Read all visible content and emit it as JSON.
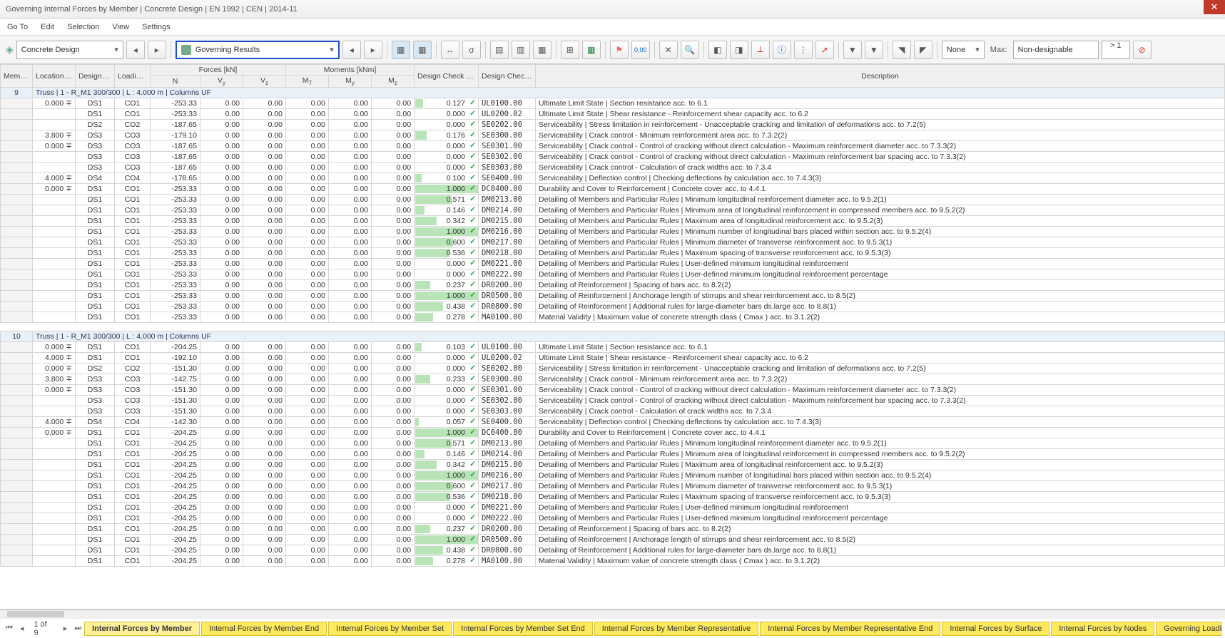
{
  "title": "Governing Internal Forces by Member | Concrete Design | EN 1992 | CEN | 2014-11",
  "menus": [
    "Go To",
    "Edit",
    "Selection",
    "View",
    "Settings"
  ],
  "toolbar": {
    "category_select": "Concrete Design",
    "result_select": "Governing Results",
    "filter1_label": "None",
    "filter2_label": "Max:",
    "filter2_value": "Non-designable",
    "gt_label": "> 1"
  },
  "headers": {
    "member": "Member No.",
    "location": "Location x [m]",
    "ds": "Design Situation",
    "lo": "Loading No.",
    "forces_group": "Forces [kN]",
    "moments_group": "Moments [kNm]",
    "ratio": "Design Check Ratio η [-]",
    "type": "Design Check Type",
    "desc": "Description",
    "N": "N",
    "Vy": "Vy",
    "Vz": "Vz",
    "Mt": "MT",
    "My": "My",
    "Mz": "Mz"
  },
  "groups": [
    {
      "member": "9",
      "title": "Truss | 1 - R_M1 300/300 | L : 4.000 m | Columns UF",
      "rows": [
        {
          "loc": "0.000",
          "ds": "DS1",
          "lo": "CO1",
          "n": "-253.33",
          "vy": "0.00",
          "vz": "0.00",
          "mt": "0.00",
          "my": "0.00",
          "mz": "0.00",
          "ratio": "0.127",
          "type": "UL0100.00",
          "desc": "Ultimate Limit State | Section resistance acc. to 6.1"
        },
        {
          "loc": "",
          "ds": "DS1",
          "lo": "CO1",
          "n": "-253.33",
          "vy": "0.00",
          "vz": "0.00",
          "mt": "0.00",
          "my": "0.00",
          "mz": "0.00",
          "ratio": "0.000",
          "type": "UL0200.02",
          "desc": "Ultimate Limit State | Shear resistance - Reinforcement shear capacity acc. to 6.2"
        },
        {
          "loc": "",
          "ds": "DS2",
          "lo": "CO2",
          "n": "-187.65",
          "vy": "0.00",
          "vz": "0.00",
          "mt": "0.00",
          "my": "0.00",
          "mz": "0.00",
          "ratio": "0.000",
          "type": "SE0202.00",
          "desc": "Serviceability | Stress limitation in reinforcement - Unacceptable cracking and limitation of deformations acc. to 7.2(5)"
        },
        {
          "loc": "3.800",
          "ds": "DS3",
          "lo": "CO3",
          "n": "-179.10",
          "vy": "0.00",
          "vz": "0.00",
          "mt": "0.00",
          "my": "0.00",
          "mz": "0.00",
          "ratio": "0.176",
          "type": "SE0300.00",
          "desc": "Serviceability | Crack control - Minimum reinforcement area acc. to 7.3.2(2)"
        },
        {
          "loc": "0.000",
          "ds": "DS3",
          "lo": "CO3",
          "n": "-187.65",
          "vy": "0.00",
          "vz": "0.00",
          "mt": "0.00",
          "my": "0.00",
          "mz": "0.00",
          "ratio": "0.000",
          "type": "SE0301.00",
          "desc": "Serviceability | Crack control - Control of cracking without direct calculation - Maximum reinforcement diameter acc. to 7.3.3(2)"
        },
        {
          "loc": "",
          "ds": "DS3",
          "lo": "CO3",
          "n": "-187.65",
          "vy": "0.00",
          "vz": "0.00",
          "mt": "0.00",
          "my": "0.00",
          "mz": "0.00",
          "ratio": "0.000",
          "type": "SE0302.00",
          "desc": "Serviceability | Crack control - Control of cracking without direct calculation - Maximum reinforcement bar spacing acc. to 7.3.3(2)"
        },
        {
          "loc": "",
          "ds": "DS3",
          "lo": "CO3",
          "n": "-187.65",
          "vy": "0.00",
          "vz": "0.00",
          "mt": "0.00",
          "my": "0.00",
          "mz": "0.00",
          "ratio": "0.000",
          "type": "SE0303.00",
          "desc": "Serviceability | Crack control - Calculation of crack widths acc. to 7.3.4"
        },
        {
          "loc": "4.000",
          "ds": "DS4",
          "lo": "CO4",
          "n": "-178.65",
          "vy": "0.00",
          "vz": "0.00",
          "mt": "0.00",
          "my": "0.00",
          "mz": "0.00",
          "ratio": "0.100",
          "type": "SE0400.00",
          "desc": "Serviceability | Deflection control | Checking deflections by calculation acc. to 7.4.3(3)"
        },
        {
          "loc": "0.000",
          "ds": "DS1",
          "lo": "CO1",
          "n": "-253.33",
          "vy": "0.00",
          "vz": "0.00",
          "mt": "0.00",
          "my": "0.00",
          "mz": "0.00",
          "ratio": "1.000",
          "type": "DC0400.00",
          "desc": "Durability and Cover to Reinforcement | Concrete cover acc. to 4.4.1"
        },
        {
          "loc": "",
          "ds": "DS1",
          "lo": "CO1",
          "n": "-253.33",
          "vy": "0.00",
          "vz": "0.00",
          "mt": "0.00",
          "my": "0.00",
          "mz": "0.00",
          "ratio": "0.571",
          "type": "DM0213.00",
          "desc": "Detailing of Members and Particular Rules | Minimum longitudinal reinforcement diameter acc. to 9.5.2(1)"
        },
        {
          "loc": "",
          "ds": "DS1",
          "lo": "CO1",
          "n": "-253.33",
          "vy": "0.00",
          "vz": "0.00",
          "mt": "0.00",
          "my": "0.00",
          "mz": "0.00",
          "ratio": "0.146",
          "type": "DM0214.00",
          "desc": "Detailing of Members and Particular Rules | Minimum area of longitudinal reinforcement in compressed members acc. to 9.5.2(2)"
        },
        {
          "loc": "",
          "ds": "DS1",
          "lo": "CO1",
          "n": "-253.33",
          "vy": "0.00",
          "vz": "0.00",
          "mt": "0.00",
          "my": "0.00",
          "mz": "0.00",
          "ratio": "0.342",
          "type": "DM0215.00",
          "desc": "Detailing of Members and Particular Rules | Maximum area of longitudinal reinforcement acc. to 9.5.2(3)"
        },
        {
          "loc": "",
          "ds": "DS1",
          "lo": "CO1",
          "n": "-253.33",
          "vy": "0.00",
          "vz": "0.00",
          "mt": "0.00",
          "my": "0.00",
          "mz": "0.00",
          "ratio": "1.000",
          "type": "DM0216.00",
          "desc": "Detailing of Members and Particular Rules | Minimum number of longitudinal bars placed within section acc. to 9.5.2(4)"
        },
        {
          "loc": "",
          "ds": "DS1",
          "lo": "CO1",
          "n": "-253.33",
          "vy": "0.00",
          "vz": "0.00",
          "mt": "0.00",
          "my": "0.00",
          "mz": "0.00",
          "ratio": "0.600",
          "type": "DM0217.00",
          "desc": "Detailing of Members and Particular Rules | Minimum diameter of transverse reinforcement acc. to 9.5.3(1)"
        },
        {
          "loc": "",
          "ds": "DS1",
          "lo": "CO1",
          "n": "-253.33",
          "vy": "0.00",
          "vz": "0.00",
          "mt": "0.00",
          "my": "0.00",
          "mz": "0.00",
          "ratio": "0.536",
          "type": "DM0218.00",
          "desc": "Detailing of Members and Particular Rules | Maximum spacing of transverse reinforcement acc. to 9.5.3(3)"
        },
        {
          "loc": "",
          "ds": "DS1",
          "lo": "CO1",
          "n": "-253.33",
          "vy": "0.00",
          "vz": "0.00",
          "mt": "0.00",
          "my": "0.00",
          "mz": "0.00",
          "ratio": "0.000",
          "type": "DM0221.00",
          "desc": "Detailing of Members and Particular Rules | User-defined minimum longitudinal reinforcement"
        },
        {
          "loc": "",
          "ds": "DS1",
          "lo": "CO1",
          "n": "-253.33",
          "vy": "0.00",
          "vz": "0.00",
          "mt": "0.00",
          "my": "0.00",
          "mz": "0.00",
          "ratio": "0.000",
          "type": "DM0222.00",
          "desc": "Detailing of Members and Particular Rules | User-defined minimum longitudinal reinforcement percentage"
        },
        {
          "loc": "",
          "ds": "DS1",
          "lo": "CO1",
          "n": "-253.33",
          "vy": "0.00",
          "vz": "0.00",
          "mt": "0.00",
          "my": "0.00",
          "mz": "0.00",
          "ratio": "0.237",
          "type": "DR0200.00",
          "desc": "Detailing of Reinforcement | Spacing of bars acc. to 8.2(2)"
        },
        {
          "loc": "",
          "ds": "DS1",
          "lo": "CO1",
          "n": "-253.33",
          "vy": "0.00",
          "vz": "0.00",
          "mt": "0.00",
          "my": "0.00",
          "mz": "0.00",
          "ratio": "1.000",
          "type": "DR0500.00",
          "desc": "Detailing of Reinforcement | Anchorage length of stirrups and shear reinforcement acc. to 8.5(2)"
        },
        {
          "loc": "",
          "ds": "DS1",
          "lo": "CO1",
          "n": "-253.33",
          "vy": "0.00",
          "vz": "0.00",
          "mt": "0.00",
          "my": "0.00",
          "mz": "0.00",
          "ratio": "0.438",
          "type": "DR0800.00",
          "desc": "Detailing of Reinforcement | Additional rules for large-diameter bars ds,large acc. to 8.8(1)"
        },
        {
          "loc": "",
          "ds": "DS1",
          "lo": "CO1",
          "n": "-253.33",
          "vy": "0.00",
          "vz": "0.00",
          "mt": "0.00",
          "my": "0.00",
          "mz": "0.00",
          "ratio": "0.278",
          "type": "MA0100.00",
          "desc": "Material Validity | Maximum value of concrete strength class ( Cmax ) acc. to 3.1.2(2)"
        }
      ]
    },
    {
      "member": "10",
      "title": "Truss | 1 - R_M1 300/300 | L : 4.000 m | Columns UF",
      "rows": [
        {
          "loc": "0.000",
          "ds": "DS1",
          "lo": "CO1",
          "n": "-204.25",
          "vy": "0.00",
          "vz": "0.00",
          "mt": "0.00",
          "my": "0.00",
          "mz": "0.00",
          "ratio": "0.103",
          "type": "UL0100.00",
          "desc": "Ultimate Limit State | Section resistance acc. to 6.1"
        },
        {
          "loc": "4.000",
          "ds": "DS1",
          "lo": "CO1",
          "n": "-192.10",
          "vy": "0.00",
          "vz": "0.00",
          "mt": "0.00",
          "my": "0.00",
          "mz": "0.00",
          "ratio": "0.000",
          "type": "UL0200.02",
          "desc": "Ultimate Limit State | Shear resistance - Reinforcement shear capacity acc. to 6.2"
        },
        {
          "loc": "0.000",
          "ds": "DS2",
          "lo": "CO2",
          "n": "-151.30",
          "vy": "0.00",
          "vz": "0.00",
          "mt": "0.00",
          "my": "0.00",
          "mz": "0.00",
          "ratio": "0.000",
          "type": "SE0202.00",
          "desc": "Serviceability | Stress limitation in reinforcement - Unacceptable cracking and limitation of deformations acc. to 7.2(5)"
        },
        {
          "loc": "3.800",
          "ds": "DS3",
          "lo": "CO3",
          "n": "-142.75",
          "vy": "0.00",
          "vz": "0.00",
          "mt": "0.00",
          "my": "0.00",
          "mz": "0.00",
          "ratio": "0.233",
          "type": "SE0300.00",
          "desc": "Serviceability | Crack control - Minimum reinforcement area acc. to 7.3.2(2)"
        },
        {
          "loc": "0.000",
          "ds": "DS3",
          "lo": "CO3",
          "n": "-151.30",
          "vy": "0.00",
          "vz": "0.00",
          "mt": "0.00",
          "my": "0.00",
          "mz": "0.00",
          "ratio": "0.000",
          "type": "SE0301.00",
          "desc": "Serviceability | Crack control - Control of cracking without direct calculation - Maximum reinforcement diameter acc. to 7.3.3(2)"
        },
        {
          "loc": "",
          "ds": "DS3",
          "lo": "CO3",
          "n": "-151.30",
          "vy": "0.00",
          "vz": "0.00",
          "mt": "0.00",
          "my": "0.00",
          "mz": "0.00",
          "ratio": "0.000",
          "type": "SE0302.00",
          "desc": "Serviceability | Crack control - Control of cracking without direct calculation - Maximum reinforcement bar spacing acc. to 7.3.3(2)"
        },
        {
          "loc": "",
          "ds": "DS3",
          "lo": "CO3",
          "n": "-151.30",
          "vy": "0.00",
          "vz": "0.00",
          "mt": "0.00",
          "my": "0.00",
          "mz": "0.00",
          "ratio": "0.000",
          "type": "SE0303.00",
          "desc": "Serviceability | Crack control - Calculation of crack widths acc. to 7.3.4"
        },
        {
          "loc": "4.000",
          "ds": "DS4",
          "lo": "CO4",
          "n": "-142.30",
          "vy": "0.00",
          "vz": "0.00",
          "mt": "0.00",
          "my": "0.00",
          "mz": "0.00",
          "ratio": "0.057",
          "type": "SE0400.00",
          "desc": "Serviceability | Deflection control | Checking deflections by calculation acc. to 7.4.3(3)"
        },
        {
          "loc": "0.000",
          "ds": "DS1",
          "lo": "CO1",
          "n": "-204.25",
          "vy": "0.00",
          "vz": "0.00",
          "mt": "0.00",
          "my": "0.00",
          "mz": "0.00",
          "ratio": "1.000",
          "type": "DC0400.00",
          "desc": "Durability and Cover to Reinforcement | Concrete cover acc. to 4.4.1"
        },
        {
          "loc": "",
          "ds": "DS1",
          "lo": "CO1",
          "n": "-204.25",
          "vy": "0.00",
          "vz": "0.00",
          "mt": "0.00",
          "my": "0.00",
          "mz": "0.00",
          "ratio": "0.571",
          "type": "DM0213.00",
          "desc": "Detailing of Members and Particular Rules | Minimum longitudinal reinforcement diameter acc. to 9.5.2(1)"
        },
        {
          "loc": "",
          "ds": "DS1",
          "lo": "CO1",
          "n": "-204.25",
          "vy": "0.00",
          "vz": "0.00",
          "mt": "0.00",
          "my": "0.00",
          "mz": "0.00",
          "ratio": "0.146",
          "type": "DM0214.00",
          "desc": "Detailing of Members and Particular Rules | Minimum area of longitudinal reinforcement in compressed members acc. to 9.5.2(2)"
        },
        {
          "loc": "",
          "ds": "DS1",
          "lo": "CO1",
          "n": "-204.25",
          "vy": "0.00",
          "vz": "0.00",
          "mt": "0.00",
          "my": "0.00",
          "mz": "0.00",
          "ratio": "0.342",
          "type": "DM0215.00",
          "desc": "Detailing of Members and Particular Rules | Maximum area of longitudinal reinforcement acc. to 9.5.2(3)"
        },
        {
          "loc": "",
          "ds": "DS1",
          "lo": "CO1",
          "n": "-204.25",
          "vy": "0.00",
          "vz": "0.00",
          "mt": "0.00",
          "my": "0.00",
          "mz": "0.00",
          "ratio": "1.000",
          "type": "DM0216.00",
          "desc": "Detailing of Members and Particular Rules | Minimum number of longitudinal bars placed within section acc. to 9.5.2(4)"
        },
        {
          "loc": "",
          "ds": "DS1",
          "lo": "CO1",
          "n": "-204.25",
          "vy": "0.00",
          "vz": "0.00",
          "mt": "0.00",
          "my": "0.00",
          "mz": "0.00",
          "ratio": "0.600",
          "type": "DM0217.00",
          "desc": "Detailing of Members and Particular Rules | Minimum diameter of transverse reinforcement acc. to 9.5.3(1)"
        },
        {
          "loc": "",
          "ds": "DS1",
          "lo": "CO1",
          "n": "-204.25",
          "vy": "0.00",
          "vz": "0.00",
          "mt": "0.00",
          "my": "0.00",
          "mz": "0.00",
          "ratio": "0.536",
          "type": "DM0218.00",
          "desc": "Detailing of Members and Particular Rules | Maximum spacing of transverse reinforcement acc. to 9.5.3(3)"
        },
        {
          "loc": "",
          "ds": "DS1",
          "lo": "CO1",
          "n": "-204.25",
          "vy": "0.00",
          "vz": "0.00",
          "mt": "0.00",
          "my": "0.00",
          "mz": "0.00",
          "ratio": "0.000",
          "type": "DM0221.00",
          "desc": "Detailing of Members and Particular Rules | User-defined minimum longitudinal reinforcement"
        },
        {
          "loc": "",
          "ds": "DS1",
          "lo": "CO1",
          "n": "-204.25",
          "vy": "0.00",
          "vz": "0.00",
          "mt": "0.00",
          "my": "0.00",
          "mz": "0.00",
          "ratio": "0.000",
          "type": "DM0222.00",
          "desc": "Detailing of Members and Particular Rules | User-defined minimum longitudinal reinforcement percentage"
        },
        {
          "loc": "",
          "ds": "DS1",
          "lo": "CO1",
          "n": "-204.25",
          "vy": "0.00",
          "vz": "0.00",
          "mt": "0.00",
          "my": "0.00",
          "mz": "0.00",
          "ratio": "0.237",
          "type": "DR0200.00",
          "desc": "Detailing of Reinforcement | Spacing of bars acc. to 8.2(2)"
        },
        {
          "loc": "",
          "ds": "DS1",
          "lo": "CO1",
          "n": "-204.25",
          "vy": "0.00",
          "vz": "0.00",
          "mt": "0.00",
          "my": "0.00",
          "mz": "0.00",
          "ratio": "1.000",
          "type": "DR0500.00",
          "desc": "Detailing of Reinforcement | Anchorage length of stirrups and shear reinforcement acc. to 8.5(2)"
        },
        {
          "loc": "",
          "ds": "DS1",
          "lo": "CO1",
          "n": "-204.25",
          "vy": "0.00",
          "vz": "0.00",
          "mt": "0.00",
          "my": "0.00",
          "mz": "0.00",
          "ratio": "0.438",
          "type": "DR0800.00",
          "desc": "Detailing of Reinforcement | Additional rules for large-diameter bars ds,large acc. to 8.8(1)"
        },
        {
          "loc": "",
          "ds": "DS1",
          "lo": "CO1",
          "n": "-204.25",
          "vy": "0.00",
          "vz": "0.00",
          "mt": "0.00",
          "my": "0.00",
          "mz": "0.00",
          "ratio": "0.278",
          "type": "MA0100.00",
          "desc": "Material Validity | Maximum value of concrete strength class ( Cmax ) acc. to 3.1.2(2)"
        }
      ]
    }
  ],
  "tabs": {
    "page_indicator": "1 of 9",
    "items": [
      "Internal Forces by Member",
      "Internal Forces by Member End",
      "Internal Forces by Member Set",
      "Internal Forces by Member Set End",
      "Internal Forces by Member Representative",
      "Internal Forces by Member Representative End",
      "Internal Forces by Surface",
      "Internal Forces by Nodes",
      "Governing Loading"
    ]
  }
}
